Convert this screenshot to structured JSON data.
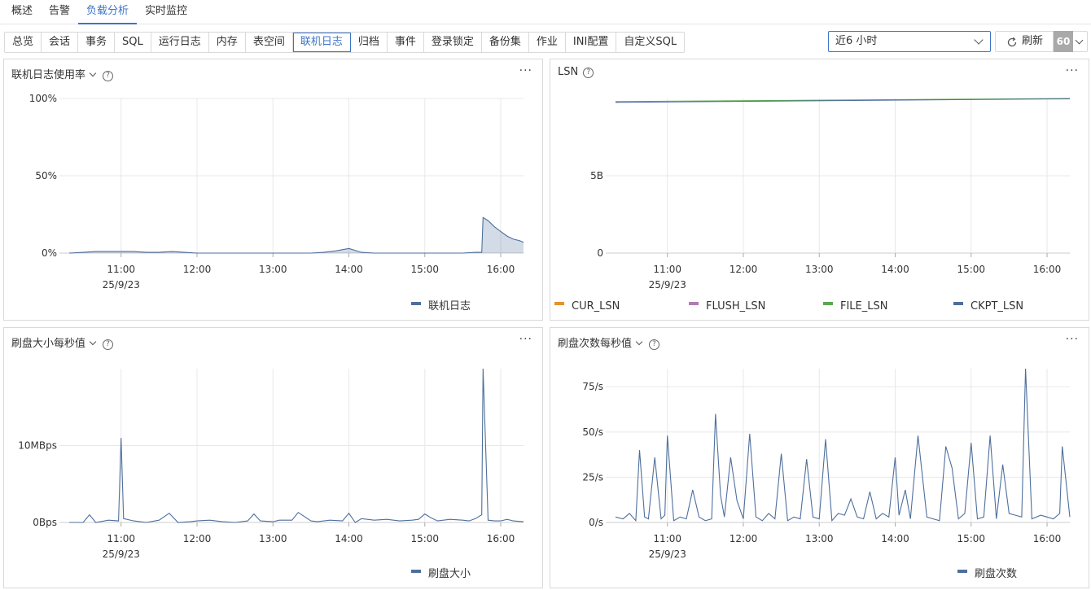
{
  "top_tabs": [
    {
      "label": "概述",
      "active": false
    },
    {
      "label": "告警",
      "active": false
    },
    {
      "label": "负载分析",
      "active": true
    },
    {
      "label": "实时监控",
      "active": false
    }
  ],
  "sub_tabs": [
    {
      "label": "总览",
      "active": false
    },
    {
      "label": "会话",
      "active": false
    },
    {
      "label": "事务",
      "active": false
    },
    {
      "label": "SQL",
      "active": false
    },
    {
      "label": "运行日志",
      "active": false
    },
    {
      "label": "内存",
      "active": false
    },
    {
      "label": "表空间",
      "active": false
    },
    {
      "label": "联机日志",
      "active": true
    },
    {
      "label": "归档",
      "active": false
    },
    {
      "label": "事件",
      "active": false
    },
    {
      "label": "登录锁定",
      "active": false
    },
    {
      "label": "备份集",
      "active": false
    },
    {
      "label": "作业",
      "active": false
    },
    {
      "label": "INI配置",
      "active": false
    },
    {
      "label": "自定义SQL",
      "active": false
    }
  ],
  "time_range": {
    "selected": "近6 小时"
  },
  "refresh": {
    "label": "刷新",
    "interval": "60"
  },
  "colors": {
    "accent": "#3c74c8",
    "series_blue": "#4e6f9c",
    "cur_lsn": "#e8912d",
    "flush_lsn": "#b27bb5",
    "file_lsn": "#5aa84f",
    "ckpt_lsn": "#4e6f9c",
    "grid": "#e8e8e8"
  },
  "panels": {
    "online_log": {
      "title": "联机日志使用率",
      "more": "···"
    },
    "lsn": {
      "title": "LSN",
      "more": "···"
    },
    "flush_size": {
      "title": "刷盘大小每秒值",
      "more": "···"
    },
    "flush_count": {
      "title": "刷盘次数每秒值",
      "more": "···"
    }
  },
  "chart_data": [
    {
      "id": "online_log",
      "type": "area",
      "title": "联机日志使用率",
      "x_ticks": [
        "11:00",
        "12:00",
        "13:00",
        "14:00",
        "15:00",
        "16:00"
      ],
      "x_date": "25/9/23",
      "y_ticks": [
        "0%",
        "50%",
        "100%"
      ],
      "ylim": [
        0,
        100
      ],
      "xlim": [
        "10:19",
        "16:18"
      ],
      "series": [
        {
          "name": "联机日志",
          "color": "#4e6f9c",
          "x": [
            "10:19",
            "10:30",
            "10:40",
            "10:50",
            "11:00",
            "11:10",
            "11:20",
            "11:30",
            "11:40",
            "11:50",
            "12:00",
            "12:10",
            "12:20",
            "12:30",
            "12:40",
            "12:50",
            "13:00",
            "13:10",
            "13:20",
            "13:30",
            "13:40",
            "13:50",
            "14:00",
            "14:10",
            "14:20",
            "14:30",
            "14:40",
            "14:50",
            "15:00",
            "15:10",
            "15:20",
            "15:30",
            "15:40",
            "15:45",
            "15:46",
            "15:50",
            "15:55",
            "16:00",
            "16:05",
            "16:10",
            "16:15",
            "16:18"
          ],
          "values": [
            0,
            0.5,
            1,
            1,
            1,
            1,
            0.5,
            0.5,
            1,
            0.5,
            0,
            0,
            0,
            0,
            0,
            0,
            0,
            0,
            0,
            0,
            0.5,
            1.5,
            3,
            0.5,
            0,
            0,
            0,
            0,
            0,
            0,
            0,
            0,
            0.5,
            0.5,
            23,
            21,
            17,
            14,
            11,
            9,
            8,
            7
          ]
        }
      ]
    },
    {
      "id": "lsn",
      "type": "line",
      "title": "LSN",
      "x_ticks": [
        "11:00",
        "12:00",
        "13:00",
        "14:00",
        "15:00",
        "16:00"
      ],
      "x_date": "25/9/23",
      "y_ticks": [
        "0",
        "5B"
      ],
      "ylim": [
        0,
        10
      ],
      "series": [
        {
          "name": "CUR_LSN",
          "color": "#e8912d"
        },
        {
          "name": "FLUSH_LSN",
          "color": "#b27bb5"
        },
        {
          "name": "FILE_LSN",
          "color": "#5aa84f",
          "x": [
            "10:19",
            "16:18"
          ],
          "values": [
            9.8,
            10
          ]
        },
        {
          "name": "CKPT_LSN",
          "color": "#4e6f9c",
          "x": [
            "10:19",
            "16:18"
          ],
          "values": [
            9.75,
            9.98
          ]
        }
      ]
    },
    {
      "id": "flush_size",
      "type": "line",
      "title": "刷盘大小每秒值",
      "x_ticks": [
        "11:00",
        "12:00",
        "13:00",
        "14:00",
        "15:00",
        "16:00"
      ],
      "x_date": "25/9/23",
      "y_ticks": [
        "0Bps",
        "10MBps"
      ],
      "ylim": [
        0,
        20
      ],
      "series": [
        {
          "name": "刷盘大小",
          "color": "#4e6f9c",
          "x": [
            "10:19",
            "10:30",
            "10:35",
            "10:40",
            "10:50",
            "10:58",
            "11:00",
            "11:02",
            "11:10",
            "11:20",
            "11:30",
            "11:38",
            "11:45",
            "11:55",
            "12:00",
            "12:10",
            "12:20",
            "12:30",
            "12:40",
            "12:45",
            "12:50",
            "13:00",
            "13:05",
            "13:15",
            "13:20",
            "13:30",
            "13:35",
            "13:45",
            "13:55",
            "14:00",
            "14:05",
            "14:10",
            "14:20",
            "14:30",
            "14:40",
            "14:50",
            "14:55",
            "15:00",
            "15:05",
            "15:10",
            "15:20",
            "15:30",
            "15:35",
            "15:40",
            "15:45",
            "15:46",
            "15:50",
            "15:55",
            "16:00",
            "16:05",
            "16:10",
            "16:18"
          ],
          "values": [
            0,
            0,
            1,
            0,
            0.3,
            0.2,
            11,
            0.5,
            0.2,
            0,
            0.3,
            1.2,
            0,
            0.1,
            0.2,
            0.3,
            0.1,
            0,
            0.2,
            1.1,
            0.2,
            0.1,
            0.3,
            0.3,
            1.3,
            0.2,
            0.1,
            0.3,
            0.2,
            1.2,
            0,
            0.5,
            0.3,
            0.4,
            0.2,
            0.3,
            0.4,
            1.1,
            0.6,
            0.2,
            0.4,
            0.3,
            0.2,
            0.5,
            1.0,
            20,
            0.3,
            0.2,
            0.2,
            0.4,
            0.2,
            0.1
          ]
        }
      ]
    },
    {
      "id": "flush_count",
      "type": "line",
      "title": "刷盘次数每秒值",
      "x_ticks": [
        "11:00",
        "12:00",
        "13:00",
        "14:00",
        "15:00",
        "16:00"
      ],
      "x_date": "25/9/23",
      "y_ticks": [
        "0/s",
        "25/s",
        "50/s",
        "75/s"
      ],
      "ylim": [
        0,
        85
      ],
      "series": [
        {
          "name": "刷盘次数",
          "color": "#4e6f9c",
          "x": [
            "10:19",
            "10:25",
            "10:30",
            "10:35",
            "10:38",
            "10:42",
            "10:45",
            "10:50",
            "10:55",
            "10:58",
            "11:00",
            "11:05",
            "11:10",
            "11:15",
            "11:20",
            "11:25",
            "11:30",
            "11:35",
            "11:38",
            "11:42",
            "11:45",
            "11:50",
            "11:55",
            "12:00",
            "12:05",
            "12:10",
            "12:15",
            "12:20",
            "12:25",
            "12:30",
            "12:35",
            "12:40",
            "12:45",
            "12:50",
            "12:55",
            "13:00",
            "13:05",
            "13:10",
            "13:15",
            "13:20",
            "13:25",
            "13:30",
            "13:35",
            "13:40",
            "13:45",
            "13:50",
            "13:55",
            "14:00",
            "14:03",
            "14:08",
            "14:12",
            "14:18",
            "14:25",
            "14:30",
            "14:35",
            "14:40",
            "14:45",
            "14:50",
            "14:55",
            "15:00",
            "15:05",
            "15:10",
            "15:15",
            "15:20",
            "15:25",
            "15:30",
            "15:35",
            "15:40",
            "15:43",
            "15:48",
            "15:55",
            "16:00",
            "16:05",
            "16:10",
            "16:12",
            "16:18"
          ],
          "values": [
            3,
            2,
            5,
            1,
            40,
            3,
            2,
            36,
            2,
            4,
            48,
            1,
            3,
            2,
            18,
            3,
            1,
            2,
            60,
            15,
            3,
            36,
            12,
            2,
            49,
            3,
            1,
            5,
            2,
            38,
            1,
            3,
            2,
            35,
            3,
            2,
            46,
            1,
            5,
            4,
            13,
            3,
            2,
            17,
            2,
            5,
            3,
            36,
            4,
            18,
            2,
            48,
            3,
            2,
            1,
            42,
            30,
            2,
            5,
            44,
            2,
            3,
            48,
            2,
            32,
            5,
            4,
            3,
            85,
            2,
            4,
            3,
            2,
            5,
            42,
            3
          ]
        }
      ]
    }
  ]
}
